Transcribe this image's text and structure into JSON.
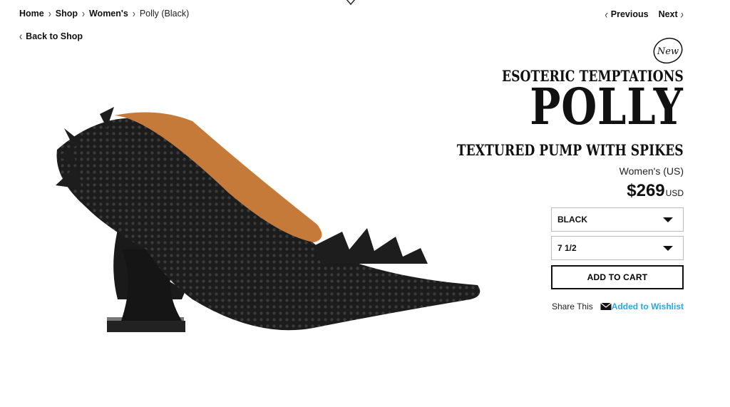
{
  "breadcrumb": {
    "items": [
      "Home",
      "Shop",
      "Women's"
    ],
    "current": "Polly (Black)"
  },
  "pager": {
    "previous": "Previous",
    "next": "Next"
  },
  "back_link": "Back to Shop",
  "product": {
    "badge": "New",
    "brand": "ESOTERIC TEMPTATIONS",
    "name": "POLLY",
    "subtitle": "TEXTURED PUMP WITH SPIKES",
    "sizing": "Women's (US)",
    "price": "$269",
    "currency": "USD",
    "color_select": "BLACK",
    "size_select": "7 1/2",
    "add_to_cart": "ADD TO CART",
    "share_label": "Share This",
    "wishlist_label": "Added to Wishlist"
  },
  "colors": {
    "accent": "#27a8e0",
    "text": "#111111",
    "border": "#bbbbbb"
  },
  "icons": {
    "top": "chevron-down-icon",
    "mail": "envelope-icon"
  }
}
